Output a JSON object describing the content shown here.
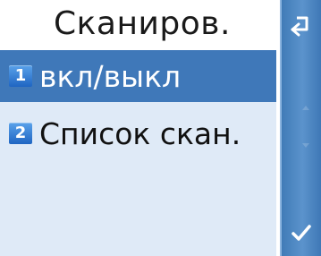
{
  "header": {
    "title": "Сканиров."
  },
  "menu": {
    "items": [
      {
        "number": "1",
        "label": "вкл/выкл",
        "selected": true
      },
      {
        "number": "2",
        "label": "Список скан.",
        "selected": false
      }
    ]
  },
  "softkeys": {
    "back_icon": "back-return-icon",
    "scroll_up_icon": "scroll-up-icon",
    "scroll_down_icon": "scroll-down-icon",
    "ok_icon": "checkmark-icon"
  },
  "colors": {
    "selection": "#3f78b9",
    "list_background": "#dfeaf7",
    "softkey_bar": "#4a85c2",
    "number_badge": "#2b7be0"
  }
}
